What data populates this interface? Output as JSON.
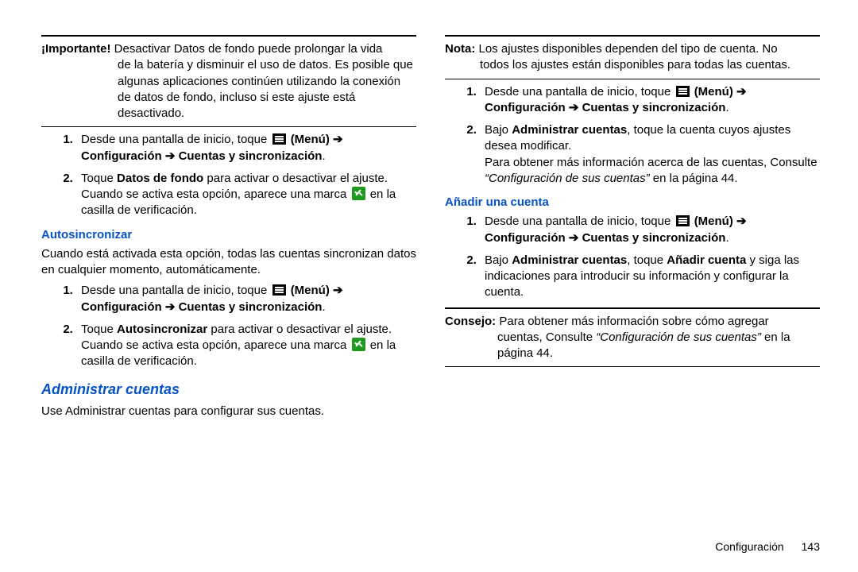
{
  "col1": {
    "importante_label": "¡Importante!",
    "importante_first": "Desactivar Datos de fondo puede prolongar la vida",
    "importante_rest": "de la batería y disminuir el uso de datos. Es posible que algunas aplicaciones continúen utilizando la conexión de datos de fondo, incluso si este ajuste está desactivado.",
    "list1": {
      "s1a": "Desde una pantalla de inicio, toque ",
      "s1_menu": "(Menú)",
      "s1_arrow": " ➔ ",
      "s1b": "Configuración ➔ Cuentas y sincronización",
      "s1c": ".",
      "s2a": "Toque ",
      "s2b": "Datos de fondo",
      "s2c": " para activar o desactivar el ajuste. Cuando se activa esta opción, aparece una marca ",
      "s2d": " en la casilla de verificación."
    },
    "auto_h": "Autosincronizar",
    "auto_lead": "Cuando está activada esta opción, todas las cuentas sincronizan datos en cualquier momento, automáticamente.",
    "list2": {
      "s1a": "Desde una pantalla de inicio, toque ",
      "s1_menu": "(Menú)",
      "s1_arrow": " ➔ ",
      "s1b": "Configuración ➔ Cuentas y sincronización",
      "s1c": ".",
      "s2a": "Toque ",
      "s2b": "Autosincronizar",
      "s2c": " para activar o desactivar el ajuste. Cuando se activa esta opción, aparece una marca ",
      "s2d": " en la casilla de verificación."
    },
    "admin_h": "Administrar cuentas",
    "admin_lead": "Use Administrar cuentas para configurar sus cuentas."
  },
  "col2": {
    "nota_label": "Nota:",
    "nota_first": "Los ajustes disponibles dependen del tipo de cuenta. No",
    "nota_rest": "todos los ajustes están disponibles para todas las cuentas.",
    "list3": {
      "s1a": "Desde una pantalla de inicio, toque ",
      "s1_menu": "(Menú)",
      "s1_arrow": " ➔ ",
      "s1b": "Configuración ➔ Cuentas y sincronización",
      "s1c": ".",
      "s2a": "Bajo ",
      "s2b": "Administrar cuentas",
      "s2c": ", toque la cuenta cuyos ajustes desea modificar.",
      "s2d": "Para obtener más información acerca de las cuentas, Consulte ",
      "s2e": "“Configuración de sus cuentas”",
      "s2f": " en la página 44."
    },
    "add_h": "Añadir una cuenta",
    "list4": {
      "s1a": "Desde una pantalla de inicio, toque ",
      "s1_menu": "(Menú)",
      "s1_arrow": " ➔ ",
      "s1b": "Configuración ➔ Cuentas y sincronización",
      "s1c": ".",
      "s2a": "Bajo ",
      "s2b": "Administrar cuentas",
      "s2c": ", toque ",
      "s2d": "Añadir cuenta",
      "s2e": " y siga las indicaciones para introducir su información y configurar la cuenta."
    },
    "tip_label": "Consejo:",
    "tip_first": "Para obtener más información sobre cómo agregar",
    "tip_rest_a": "cuentas, Consulte ",
    "tip_rest_i": "“Configuración de sus cuentas”",
    "tip_rest_b": " en la página 44."
  },
  "footer": {
    "section": "Configuración",
    "page": "143"
  }
}
